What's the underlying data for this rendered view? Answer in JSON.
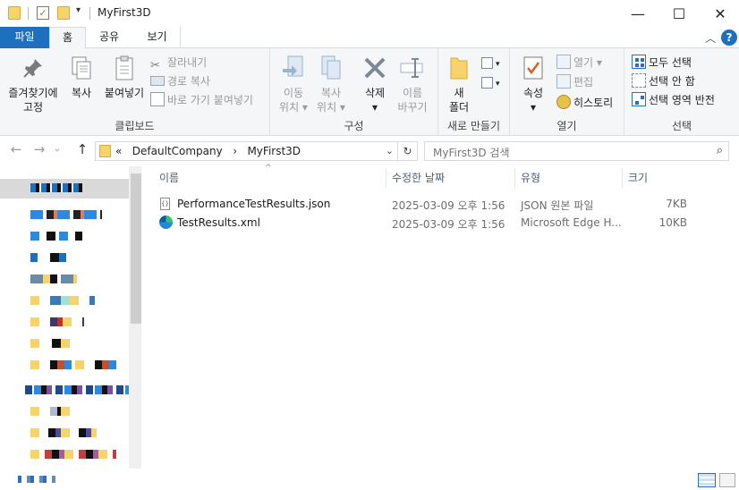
{
  "window": {
    "title": "MyFirst3D",
    "minimize": "—",
    "maximize": "☐",
    "close": "✕"
  },
  "tabs": [
    {
      "label": "파일"
    },
    {
      "label": "홈"
    },
    {
      "label": "공유"
    },
    {
      "label": "보기"
    }
  ],
  "ribbon": {
    "clipboard": {
      "group_label": "클립보드",
      "pin": "즐겨찾기에\n고정",
      "copy": "복사",
      "paste": "붙여넣기",
      "cut": "잘라내기",
      "copy_path": "경로 복사",
      "paste_shortcut": "바로 가기 붙여넣기"
    },
    "organize": {
      "group_label": "구성",
      "move_to": "이동\n위치 ▾",
      "copy_to": "복사\n위치 ▾",
      "delete": "삭제\n▾",
      "rename": "이름\n바꾸기"
    },
    "new": {
      "group_label": "새로 만들기",
      "new_folder": "새\n폴더"
    },
    "open": {
      "group_label": "열기",
      "properties": "속성\n▾",
      "open": "열기 ▾",
      "edit": "편집",
      "history": "히스토리"
    },
    "select": {
      "group_label": "선택",
      "select_all": "모두 선택",
      "select_none": "선택 안 함",
      "invert": "선택 영역 반전"
    }
  },
  "address": {
    "prefix": "«",
    "crumb1": "DefaultCompany",
    "separator": "›",
    "crumb2": "MyFirst3D",
    "search_placeholder": "MyFirst3D 검색"
  },
  "columns": {
    "name": "이름",
    "modified": "수정한 날짜",
    "type": "유형",
    "size": "크기"
  },
  "files": [
    {
      "name": "PerformanceTestResults.json",
      "modified": "2025-03-09 오후 1:56",
      "type": "JSON 원본 파일",
      "size": "7KB",
      "icon": "json-file-icon"
    },
    {
      "name": "TestResults.xml",
      "modified": "2025-03-09 오후 1:56",
      "type": "Microsoft Edge H...",
      "size": "10KB",
      "icon": "edge-icon"
    }
  ],
  "colors": {
    "file_tab": "#1e6fbf",
    "folder": "#f7d46a",
    "header_text": "#4c607a"
  }
}
